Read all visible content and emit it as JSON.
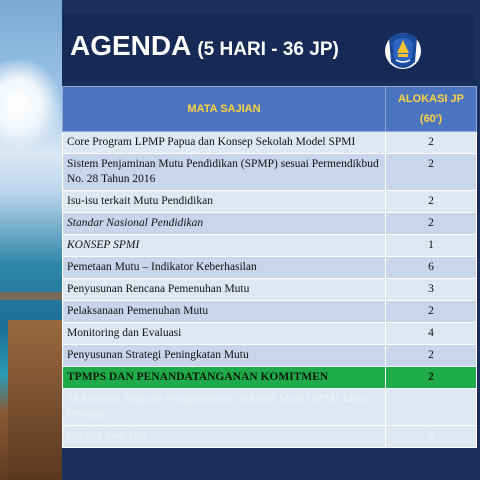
{
  "slide": {
    "title_main": "AGENDA",
    "title_sub": "(5 HARI - 36 JP)"
  },
  "logo": {
    "icon": "tut-wuri-handayani-emblem-icon",
    "colors": [
      "#1a4a9c",
      "#f2c230",
      "#ffffff"
    ]
  },
  "table": {
    "headers": [
      "MATA SAJIAN",
      "ALOKASI JP (60')"
    ],
    "rows": [
      {
        "subject": "Core Program LPMP Papua dan Konsep Sekolah Model SPMI",
        "jp": "2",
        "style": "light",
        "italic": false
      },
      {
        "subject": "Sistem Penjaminan Mutu Pendidikan (SPMP) sesuai Permendikbud No. 28 Tahun 2016",
        "jp": "2",
        "style": "dark",
        "italic": false
      },
      {
        "subject": "Isu-isu terkait Mutu Pendidikan",
        "jp": "2",
        "style": "light",
        "italic": false
      },
      {
        "subject": "Standar Nasional Pendidikan",
        "jp": "2",
        "style": "dark",
        "italic": true
      },
      {
        "subject": "KONSEP SPMI",
        "jp": "1",
        "style": "light",
        "italic": true
      },
      {
        "subject": "Pemetaan Mutu – Indikator Keberhasilan",
        "jp": "6",
        "style": "dark",
        "italic": false
      },
      {
        "subject": "Penyusunan Rencana Pemenuhan Mutu",
        "jp": "3",
        "style": "light",
        "italic": false
      },
      {
        "subject": "Pelaksanaan Pemenuhan Mutu",
        "jp": "2",
        "style": "dark",
        "italic": false
      },
      {
        "subject": "Monitoring dan Evaluasi",
        "jp": "4",
        "style": "light",
        "italic": false
      },
      {
        "subject": "Penyusunan Strategi Peningkatan Mutu",
        "jp": "2",
        "style": "dark",
        "italic": false
      },
      {
        "subject": "TPMPS DAN PENANDATANGANAN KOMITMEN",
        "jp": "2",
        "style": "hl",
        "italic": false
      },
      {
        "subject": "Mekanisme Program Pengembangan Sekolah Model SPMI Tahun Pertama",
        "jp": "2",
        "style": "faded",
        "italic": false
      },
      {
        "subject": "Pre dan Post Test",
        "jp": "2",
        "style": "faded",
        "italic": false
      }
    ]
  },
  "colors": {
    "background": "#1b2f5c",
    "header_bg": "#4b75c0",
    "header_text": "#ffd23f",
    "row_light": "#dfe7f3",
    "row_dark": "#c8d5ea",
    "highlight": "#1fab4a"
  }
}
